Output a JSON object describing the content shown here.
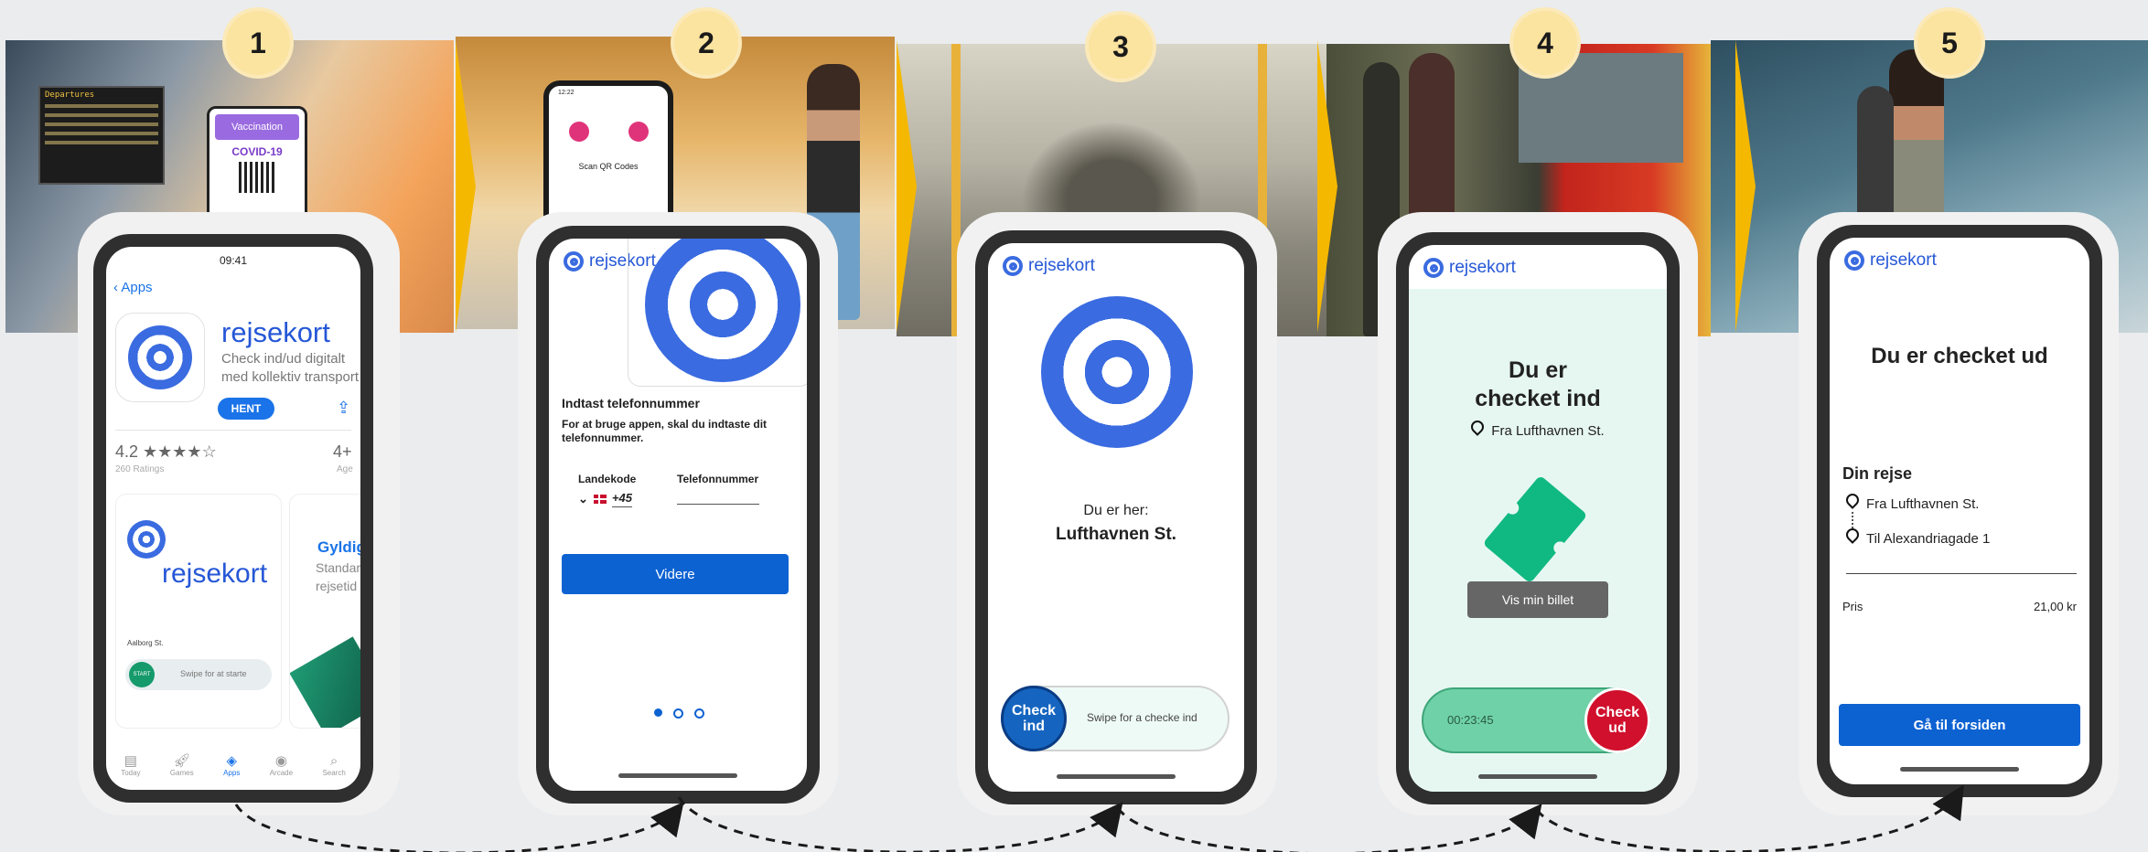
{
  "steps": [
    "1",
    "2",
    "3",
    "4",
    "5"
  ],
  "phone1": {
    "time": "09:41",
    "back": "Apps",
    "app_name": "rejsekort",
    "subtitle_line1": "Check ind/ud digitalt",
    "subtitle_line2": "med kollektiv transport",
    "get": "HENT",
    "rating": "4.2 ★★★★☆",
    "ratings_count": "260 Ratings",
    "age": "4+",
    "age_label": "Age",
    "card_logo": "rejsekort",
    "card2_title": "Gyldig",
    "card2_line1": "Standar",
    "card2_line2": "rejsetid",
    "station": "Aalborg St.",
    "swipe_hint": "Swipe for at starte",
    "start": "START",
    "tabs": [
      "Today",
      "Games",
      "Apps",
      "Arcade",
      "Search"
    ]
  },
  "phone2": {
    "logo": "rejsekort",
    "title": "Indtast telefonnummer",
    "desc": "For at bruge appen, skal du indtaste dit telefonnummer.",
    "country_label": "Landekode",
    "country_value": "+45",
    "phone_label": "Telefonnummer",
    "continue": "Videre",
    "bg_phone_time": "12:22",
    "bg_phone_scan": "Scan QR Codes"
  },
  "phone3": {
    "logo": "rejsekort",
    "you_are": "Du er her:",
    "station": "Lufthavnen St.",
    "checkin_line1": "Check",
    "checkin_line2": "ind",
    "swipe": "Swipe for a checke ind"
  },
  "phone4": {
    "logo": "rejsekort",
    "title_line1": "Du er",
    "title_line2": "checket ind",
    "from": "Fra Lufthavnen St.",
    "show_ticket": "Vis min billet",
    "timer": "00:23:45",
    "checkout_line1": "Check",
    "checkout_line2": "ud"
  },
  "phone5": {
    "logo": "rejsekort",
    "title": "Du er checket ud",
    "journey": "Din rejse",
    "from": "Fra Lufthavnen St.",
    "to": "Til Alexandriagade 1",
    "price_label": "Pris",
    "price": "21,00 kr",
    "home": "Gå til forsiden"
  },
  "photo1": {
    "board_title": "Departures",
    "cert_line": "Vaccination",
    "cert_label": "COVID-19"
  },
  "colors": {
    "accent": "#0d62d2",
    "brand": "#3a6be0",
    "mint": "#e6f7f1",
    "green": "#10b981",
    "red": "#d0102c",
    "badge": "#fbe3a0",
    "chevron": "#f5b800"
  }
}
